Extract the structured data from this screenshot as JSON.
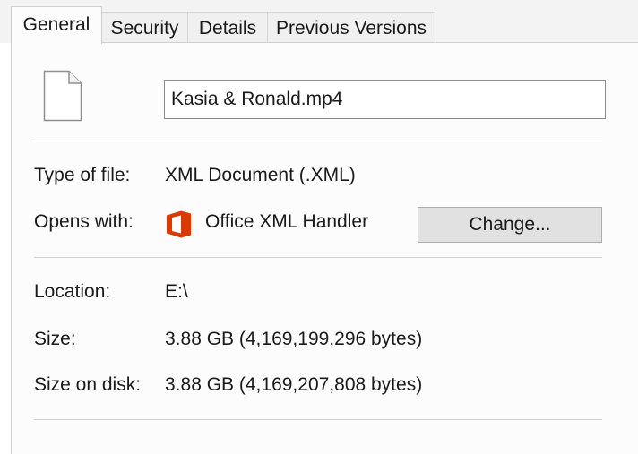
{
  "tabs": [
    {
      "label": "General",
      "active": true
    },
    {
      "label": "Security",
      "active": false
    },
    {
      "label": "Details",
      "active": false
    },
    {
      "label": "Previous Versions",
      "active": false
    }
  ],
  "file": {
    "name": "Kasia & Ronald.mp4",
    "icon": "blank-document-icon"
  },
  "fields": {
    "type_label": "Type of file:",
    "type_value": "XML Document (.XML)",
    "opens_label": "Opens with:",
    "opens_value": "Office XML Handler",
    "opens_icon": "office-logo-icon",
    "change_label": "Change...",
    "location_label": "Location:",
    "location_value": "E:\\",
    "size_label": "Size:",
    "size_value": "3.88 GB (4,169,199,296 bytes)",
    "size_disk_label": "Size on disk:",
    "size_disk_value": "3.88 GB (4,169,207,808 bytes)"
  },
  "colors": {
    "office_accent": "#D83B01",
    "button_bg": "#E1E1E1"
  }
}
